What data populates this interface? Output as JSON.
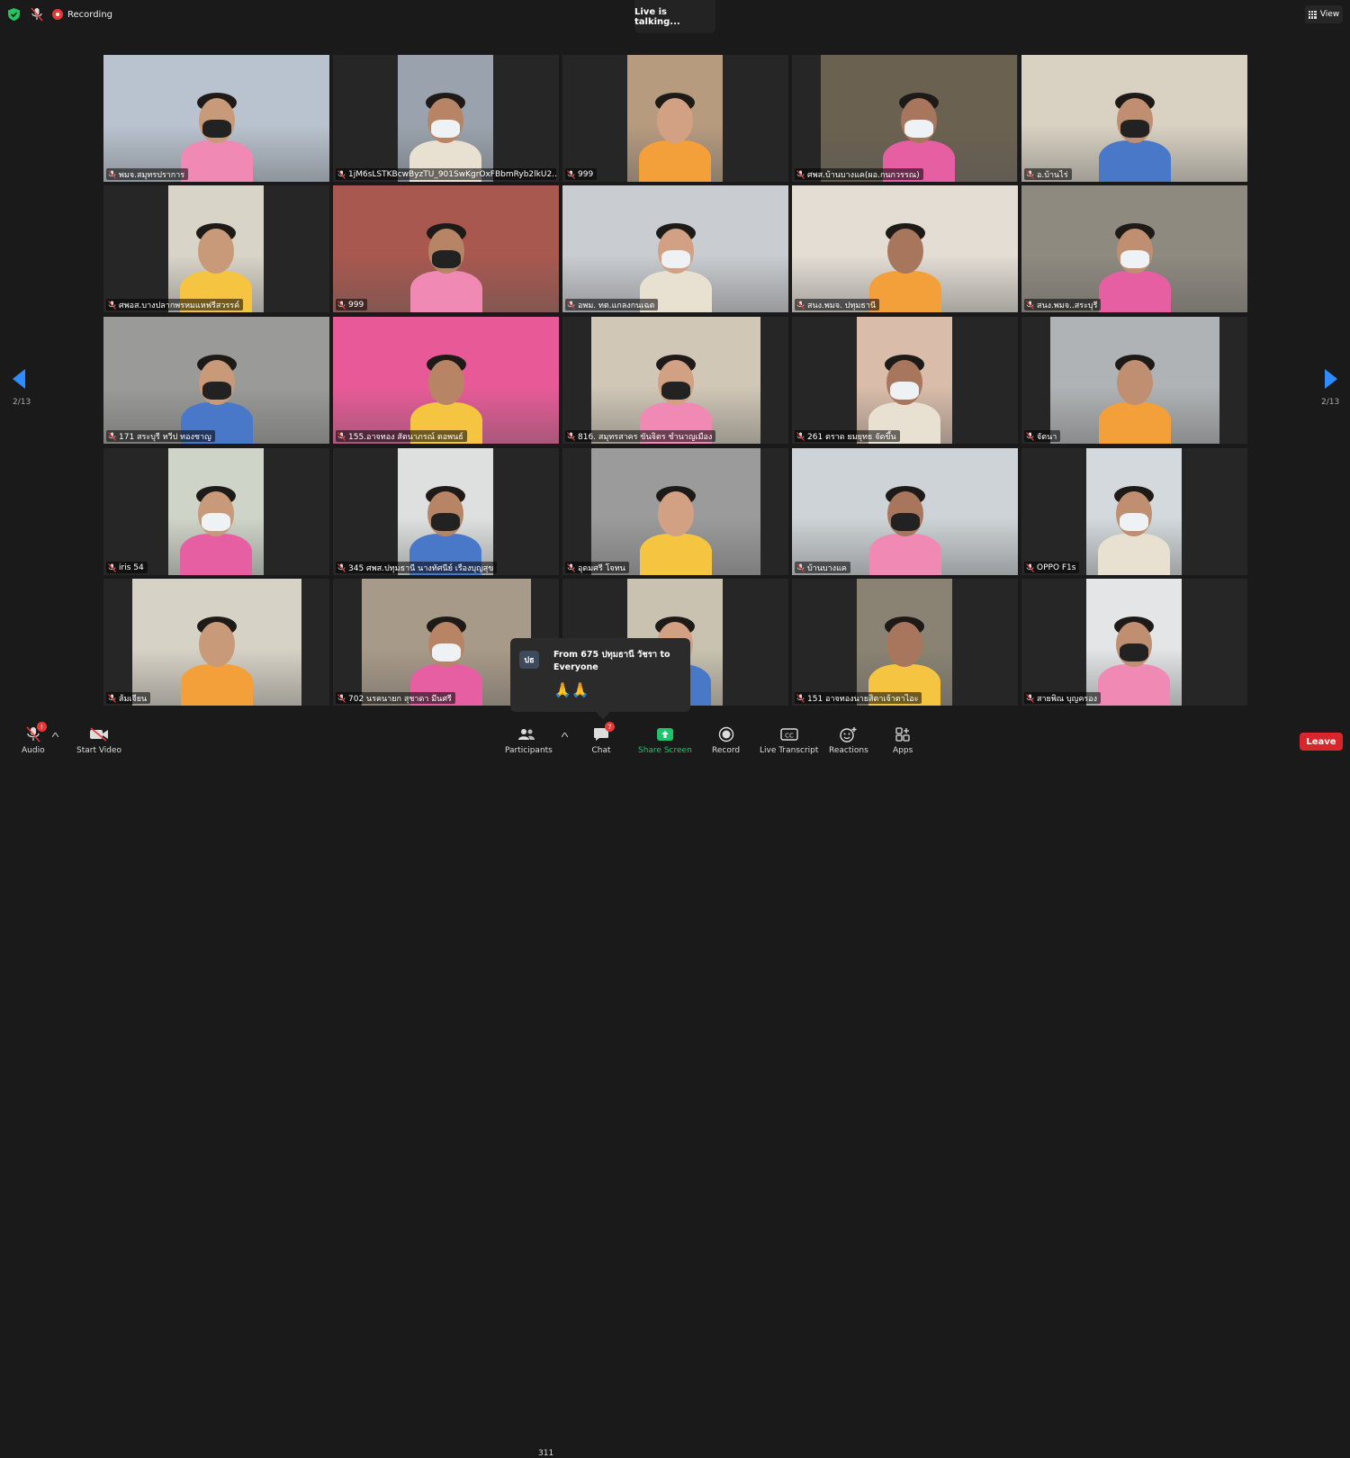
{
  "topbar": {
    "recording_label": "Recording",
    "live_label": "Live is talking...",
    "view_label": "View"
  },
  "pagination": {
    "left": "2/13",
    "right": "2/13"
  },
  "participants": [
    {
      "name": "พมจ.สมุทรปราการ",
      "scene": "#b9c3cf"
    },
    {
      "name": "1jM6sLSTKBcwByzTU_901SwKgrOxFBbmRyb2lkU2...",
      "scene": "#9aa3ad"
    },
    {
      "name": "999",
      "scene": "#b79b7f"
    },
    {
      "name": "ศพส.บ้านบางแค(ผอ.กนกวรรณ)",
      "scene": "#6b6150"
    },
    {
      "name": "อ.บ้านไร่",
      "scene": "#d9d2c3"
    },
    {
      "name": "ศพอส.บางปลากพรหมแหฟรีสวรรค์",
      "scene": "#d8d4c8"
    },
    {
      "name": "999",
      "scene": "#a8584f"
    },
    {
      "name": "อพม. ทต.แกลงกนเฉต",
      "scene": "#c9ccd0"
    },
    {
      "name": "สนง.พมจ. ปทุมธานี",
      "scene": "#e3ddd4"
    },
    {
      "name": "สนง.พมจ..สระบุรี",
      "scene": "#8f8a80"
    },
    {
      "name": "171 สระบุรี หวีป ทองชาญ",
      "scene": "#9a9a98"
    },
    {
      "name": "155.อาจทอง สัตนาภรณ์ ตอพนธ์",
      "scene": "#e85a97"
    },
    {
      "name": "816. สมุทรสาคร ขันจิตร ชำนาญเมือง",
      "scene": "#d0c7b6"
    },
    {
      "name": "261 ตราด ยมยุทธ จัดขึ้น",
      "scene": "#d9bdaa"
    },
    {
      "name": "จัตนา",
      "scene": "#b0b3b5"
    },
    {
      "name": "iris 54",
      "scene": "#cfd4c8"
    },
    {
      "name": "345 ศพส.ปทุมธานี นางทัศนีย์ เรืองบุญสุข",
      "scene": "#dde0de"
    },
    {
      "name": "อุดมศรี โจทน",
      "scene": "#9b9b9b"
    },
    {
      "name": "บ้านบางแค",
      "scene": "#cdd3d6"
    },
    {
      "name": "OPPO F1s",
      "scene": "#d3d9dc"
    },
    {
      "name": "ส้มเจียน",
      "scene": "#d7d2c6"
    },
    {
      "name": "702 นรคนายก สุชาดา มีนศรี",
      "scene": "#a89a88"
    },
    {
      "name": "",
      "scene": "#c9c2b0"
    },
    {
      "name": "151 อาจทองนายสิตาเจ้าตาไอะ",
      "scene": "#8a8373"
    },
    {
      "name": "สายพิณ บุญครอง",
      "scene": "#e3e5e6"
    }
  ],
  "chat_popup": {
    "avatar": "ปธ",
    "from": "From 675 ปทุมธานี วัชรา to Everyone",
    "message": "🙏🙏"
  },
  "toolbar": {
    "audio": "Audio",
    "audio_badge": "!",
    "start_video": "Start Video",
    "participants": "Participants",
    "participant_count": "311",
    "chat": "Chat",
    "chat_badge": "7",
    "share_screen": "Share Screen",
    "record": "Record",
    "live_transcript": "Live Transcript",
    "reactions": "Reactions",
    "apps": "Apps",
    "leave": "Leave"
  },
  "colors": {
    "share_green": "#21c36a",
    "leave_red": "#d9262c",
    "pagination_arrow": "#2d8cff",
    "muted_red": "#e53935"
  }
}
